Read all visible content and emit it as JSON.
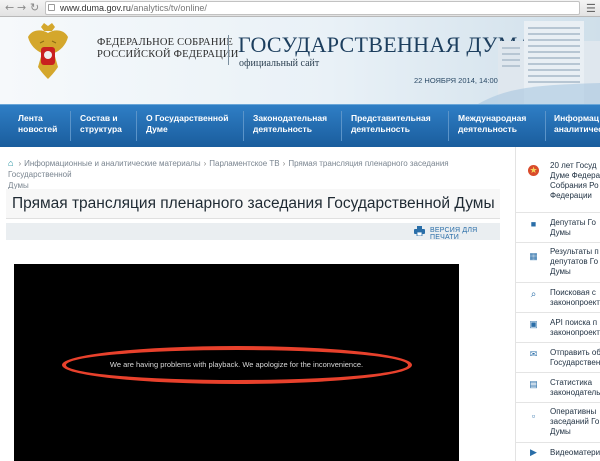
{
  "browser": {
    "url_host": "www.duma.gov.ru",
    "url_path": "/analytics/tv/online/"
  },
  "header": {
    "org_line1": "ФЕДЕРАЛЬНОЕ СОБРАНИЕ",
    "org_line2": "РОССИЙСКОЙ ФЕДЕРАЦИИ",
    "site_title": "ГОСУДАРСТВЕННАЯ ДУМА",
    "site_subtitle": "официальный сайт",
    "datetime": "22 НОЯБРЯ 2014, 14:00 МСК"
  },
  "nav": {
    "items": [
      {
        "line1": "Лента",
        "line2": "новостей"
      },
      {
        "line1": "Состав и",
        "line2": "структура"
      },
      {
        "line1": "О Государственной",
        "line2": "Думе"
      },
      {
        "line1": "Законодательная",
        "line2": "деятельность"
      },
      {
        "line1": "Представительная",
        "line2": "деятельность"
      },
      {
        "line1": "Международная",
        "line2": "деятельность"
      },
      {
        "line1": "Информац",
        "line2": "аналитичес"
      }
    ]
  },
  "breadcrumb": {
    "items": [
      "Информационные и аналитические материалы",
      "Парламентское ТВ",
      "Прямая трансляция пленарного заседания Государственной",
      "Думы"
    ]
  },
  "page": {
    "title": "Прямая трансляция пленарного заседания Государственной Думы",
    "print_label": "ВЕРСИЯ ДЛЯ ПЕЧАТИ",
    "player_message": "We are having problems with playback. We apologize for the inconvenience."
  },
  "sidebar": {
    "items": [
      {
        "icon": "anniversary-icon",
        "lines": [
          "20 лет Госуд",
          "Думе Федера",
          "Собрания Ро",
          "Федерации"
        ]
      },
      {
        "icon": "deputies-icon",
        "lines": [
          "Депутаты Го",
          "Думы"
        ]
      },
      {
        "icon": "results-icon",
        "lines": [
          "Результаты п",
          "депутатов Го",
          "Думы"
        ]
      },
      {
        "icon": "search-icon",
        "lines": [
          "Поисковая с",
          "законопроект"
        ]
      },
      {
        "icon": "api-icon",
        "lines": [
          "API поиска п",
          "законопроект"
        ]
      },
      {
        "icon": "mail-icon",
        "lines": [
          "Отправить об",
          "Государствен"
        ]
      },
      {
        "icon": "statistics-icon",
        "lines": [
          "Статистика",
          "законодатель"
        ]
      },
      {
        "icon": "calendar-icon",
        "lines": [
          "Оперативны",
          "заседаний Го",
          "Думы"
        ]
      },
      {
        "icon": "video-icon",
        "lines": [
          "Видеоматери"
        ]
      }
    ]
  },
  "colors": {
    "nav_blue": "#1f65a8",
    "highlight_red": "#e8412c",
    "title_blue": "#1c3e5e"
  }
}
